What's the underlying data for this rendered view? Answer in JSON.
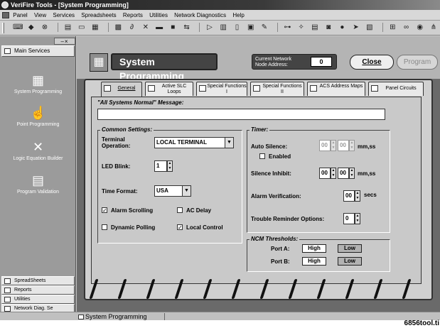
{
  "window": {
    "title": "VeriFire Tools - [System Programming]"
  },
  "menu": [
    "Panel",
    "View",
    "Services",
    "Spreadsheets",
    "Reports",
    "Utilities",
    "Network Diagnostics",
    "Help"
  ],
  "sidebar": {
    "header": "Main Services",
    "items": [
      {
        "label": "System Programming",
        "icon": "cpu-icon"
      },
      {
        "label": "Point Programming",
        "icon": "hand-pointer-icon"
      },
      {
        "label": "Logic Equation Builder",
        "icon": "tools-icon"
      },
      {
        "label": "Program Validation",
        "icon": "checklist-icon"
      }
    ],
    "footer": [
      "SpreadSheets",
      "Reports",
      "Utilities",
      "Network Diag. Se"
    ]
  },
  "header": {
    "title": "System Programming",
    "node_label_1": "Current Network",
    "node_label_2": "Node Address:",
    "node_value": "0",
    "close_label": "Close",
    "program_label": "Program"
  },
  "tabs": [
    {
      "label": "General",
      "icon": "document-icon"
    },
    {
      "label": "Active SLC Loops",
      "icon": "loop-icon"
    },
    {
      "label": "Special Functions I",
      "icon": "function-icon"
    },
    {
      "label": "Special Functions II",
      "icon": "function-icon"
    },
    {
      "label": "ACS Address Maps",
      "icon": "tag-icon"
    },
    {
      "label": "Panel Circuits",
      "icon": "panel-icon"
    }
  ],
  "form": {
    "normal_msg_label": "\"All Systems Normal\" Message:",
    "normal_msg_value": "",
    "common_legend": "Common Settings:",
    "terminal_label_1": "Terminal",
    "terminal_label_2": "Operation:",
    "terminal_value": "LOCAL TERMINAL",
    "led_label": "LED Blink:",
    "led_value": "1",
    "time_format_label": "Time Format:",
    "time_format_value": "USA",
    "checks": {
      "alarm_scrolling": {
        "label": "Alarm Scrolling",
        "checked": "✓"
      },
      "ac_delay": {
        "label": "AC Delay",
        "checked": ""
      },
      "dynamic_polling": {
        "label": "Dynamic Polling",
        "checked": ""
      },
      "local_control": {
        "label": "Local Control",
        "checked": "✓"
      }
    },
    "timer_legend": "Timer:",
    "auto_silence_label": "Auto Silence:",
    "auto_silence_mm": "00",
    "auto_silence_ss": "00",
    "auto_silence_unit": "mm,ss",
    "enabled_label": "Enabled",
    "enabled_checked": "",
    "silence_inhibit_label": "Silence Inhibit:",
    "silence_inhibit_mm": "00",
    "silence_inhibit_ss": "00",
    "silence_inhibit_unit": "mm,ss",
    "alarm_verif_label": "Alarm Verification:",
    "alarm_verif_value": "00",
    "alarm_verif_unit": "secs",
    "trouble_label": "Trouble Reminder Options:",
    "trouble_value": "0",
    "ncm_legend": "NCM Thresholds:",
    "port_a_label": "Port A:",
    "port_b_label": "Port B:",
    "high_label": "High",
    "low_label": "Low",
    "port_a_selected": "Low",
    "port_b_selected": "Low"
  },
  "status": {
    "item": "System Programming"
  },
  "watermark": "6856tool.ti"
}
